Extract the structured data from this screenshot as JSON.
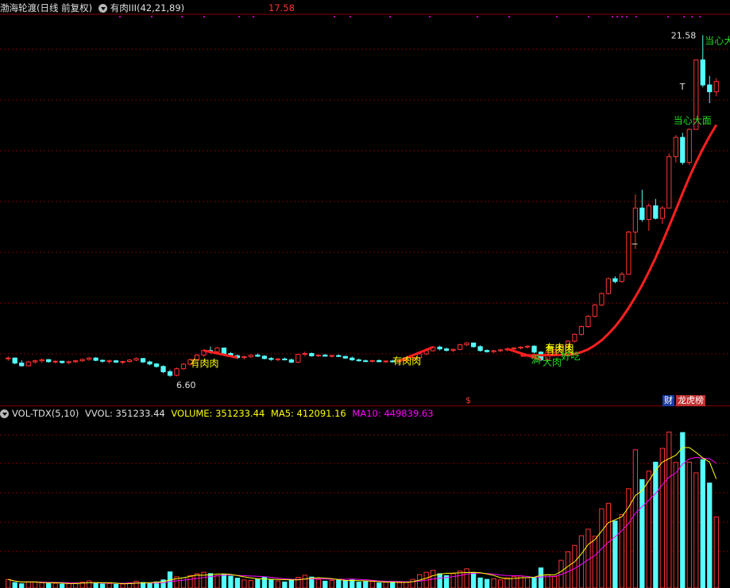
{
  "header": {
    "stock_title": "渤海轮渡(日线 前复权)",
    "indicator_name": "有肉III",
    "indicator_params": "(42,21,89)",
    "top_price": "17.58"
  },
  "volume_header": {
    "indicator": "VOL-TDX(5,10)",
    "vvol": "VVOL: 351233.44",
    "volume": "VOLUME: 351233.44",
    "ma5": "MA5: 412091.16",
    "ma10": "MA10: 449839.63"
  },
  "badges": {
    "cai": "财",
    "longhu": "龙虎榜",
    "dollar": "$"
  },
  "price_labels": {
    "low": "6.60",
    "high": "21.58"
  },
  "colors": {
    "up": "#ff3232",
    "down": "#54ffff",
    "grid": "#7a0000",
    "bull_line": "#ff2020",
    "ma5": "#ffff00",
    "ma10": "#ff00ff",
    "signal_green": "#22dd22",
    "signal_text": "#ffff00"
  },
  "chart_data": [
    {
      "type": "candlestick",
      "title": "渤海轮渡(日线 前复权)",
      "ylim": [
        6.0,
        22.5
      ],
      "candles": [
        [
          7.4,
          7.5,
          7.3,
          7.42
        ],
        [
          7.42,
          7.45,
          7.15,
          7.2
        ],
        [
          7.2,
          7.32,
          7.05,
          7.08
        ],
        [
          7.08,
          7.3,
          7.05,
          7.25
        ],
        [
          7.25,
          7.35,
          7.18,
          7.3
        ],
        [
          7.3,
          7.4,
          7.22,
          7.35
        ],
        [
          7.35,
          7.38,
          7.22,
          7.26
        ],
        [
          7.26,
          7.32,
          7.18,
          7.28
        ],
        [
          7.28,
          7.3,
          7.18,
          7.22
        ],
        [
          7.22,
          7.3,
          7.15,
          7.26
        ],
        [
          7.26,
          7.34,
          7.2,
          7.3
        ],
        [
          7.3,
          7.4,
          7.25,
          7.36
        ],
        [
          7.36,
          7.48,
          7.3,
          7.42
        ],
        [
          7.42,
          7.46,
          7.28,
          7.32
        ],
        [
          7.32,
          7.36,
          7.22,
          7.28
        ],
        [
          7.28,
          7.35,
          7.18,
          7.3
        ],
        [
          7.3,
          7.34,
          7.2,
          7.24
        ],
        [
          7.24,
          7.3,
          7.15,
          7.27
        ],
        [
          7.27,
          7.38,
          7.22,
          7.33
        ],
        [
          7.33,
          7.45,
          7.28,
          7.4
        ],
        [
          7.4,
          7.42,
          7.2,
          7.25
        ],
        [
          7.25,
          7.3,
          7.1,
          7.16
        ],
        [
          7.16,
          7.2,
          7.0,
          7.05
        ],
        [
          7.05,
          7.1,
          6.75,
          6.82
        ],
        [
          6.82,
          6.9,
          6.6,
          6.66
        ],
        [
          6.66,
          7.0,
          6.62,
          6.95
        ],
        [
          6.95,
          7.2,
          6.9,
          7.15
        ],
        [
          7.15,
          7.4,
          7.1,
          7.35
        ],
        [
          7.35,
          7.6,
          7.3,
          7.55
        ],
        [
          7.55,
          7.8,
          7.48,
          7.75
        ],
        [
          7.75,
          7.92,
          7.62,
          7.7
        ],
        [
          7.7,
          7.9,
          7.6,
          7.86
        ],
        [
          7.86,
          7.88,
          7.55,
          7.62
        ],
        [
          7.62,
          7.68,
          7.45,
          7.52
        ],
        [
          7.52,
          7.58,
          7.38,
          7.44
        ],
        [
          7.44,
          7.52,
          7.36,
          7.48
        ],
        [
          7.48,
          7.58,
          7.42,
          7.55
        ],
        [
          7.55,
          7.62,
          7.46,
          7.5
        ],
        [
          7.5,
          7.55,
          7.36,
          7.4
        ],
        [
          7.4,
          7.46,
          7.3,
          7.36
        ],
        [
          7.36,
          7.42,
          7.28,
          7.38
        ],
        [
          7.38,
          7.44,
          7.32,
          7.34
        ],
        [
          7.34,
          7.4,
          7.2,
          7.24
        ],
        [
          7.24,
          7.6,
          7.2,
          7.58
        ],
        [
          7.58,
          7.7,
          7.5,
          7.62
        ],
        [
          7.62,
          7.66,
          7.48,
          7.52
        ],
        [
          7.52,
          7.58,
          7.46,
          7.55
        ],
        [
          7.55,
          7.6,
          7.48,
          7.5
        ],
        [
          7.5,
          7.56,
          7.44,
          7.53
        ],
        [
          7.53,
          7.58,
          7.46,
          7.49
        ],
        [
          7.49,
          7.52,
          7.38,
          7.42
        ],
        [
          7.42,
          7.48,
          7.3,
          7.34
        ],
        [
          7.34,
          7.4,
          7.26,
          7.3
        ],
        [
          7.3,
          7.35,
          7.24,
          7.28
        ],
        [
          7.28,
          7.34,
          7.22,
          7.31
        ],
        [
          7.31,
          7.36,
          7.24,
          7.26
        ],
        [
          7.26,
          7.32,
          7.2,
          7.29
        ],
        [
          7.29,
          7.34,
          7.22,
          7.27
        ],
        [
          7.27,
          7.33,
          7.2,
          7.3
        ],
        [
          7.3,
          7.38,
          7.26,
          7.35
        ],
        [
          7.35,
          7.48,
          7.32,
          7.44
        ],
        [
          7.44,
          7.64,
          7.4,
          7.6
        ],
        [
          7.6,
          7.8,
          7.55,
          7.74
        ],
        [
          7.74,
          7.95,
          7.7,
          7.9
        ],
        [
          7.9,
          7.96,
          7.76,
          7.82
        ],
        [
          7.82,
          7.88,
          7.7,
          7.76
        ],
        [
          7.76,
          7.84,
          7.68,
          7.8
        ],
        [
          7.8,
          8.05,
          7.76,
          8.0
        ],
        [
          8.0,
          8.12,
          7.95,
          8.08
        ],
        [
          8.08,
          8.1,
          7.88,
          7.92
        ],
        [
          7.92,
          7.98,
          7.7,
          7.75
        ],
        [
          7.75,
          7.8,
          7.66,
          7.7
        ],
        [
          7.7,
          7.78,
          7.64,
          7.74
        ],
        [
          7.74,
          7.82,
          7.68,
          7.78
        ],
        [
          7.78,
          7.86,
          7.72,
          7.82
        ],
        [
          7.82,
          7.9,
          7.76,
          7.86
        ],
        [
          7.86,
          7.94,
          7.8,
          7.9
        ],
        [
          7.9,
          7.98,
          7.84,
          7.94
        ],
        [
          7.94,
          7.98,
          7.62,
          7.68
        ],
        [
          7.68,
          7.72,
          7.28,
          7.35
        ],
        [
          7.35,
          7.72,
          7.3,
          7.68
        ],
        [
          7.68,
          7.82,
          7.6,
          7.78
        ],
        [
          7.78,
          8.0,
          7.72,
          7.92
        ],
        [
          7.92,
          8.2,
          7.88,
          8.16
        ],
        [
          8.16,
          8.5,
          8.1,
          8.46
        ],
        [
          8.46,
          8.85,
          8.4,
          8.8
        ],
        [
          8.8,
          9.3,
          8.75,
          9.25
        ],
        [
          9.25,
          9.8,
          9.2,
          9.75
        ],
        [
          9.75,
          10.3,
          9.7,
          10.25
        ],
        [
          10.25,
          10.95,
          10.2,
          10.9
        ],
        [
          10.9,
          11.0,
          10.7,
          10.78
        ],
        [
          10.78,
          11.2,
          10.72,
          11.1
        ],
        [
          11.1,
          13.0,
          11.1,
          12.95
        ],
        [
          12.95,
          14.6,
          12.2,
          14.0
        ],
        [
          14.0,
          14.8,
          13.4,
          13.5
        ],
        [
          13.5,
          14.2,
          13.0,
          14.1
        ],
        [
          14.1,
          14.4,
          13.5,
          13.55
        ],
        [
          13.55,
          14.1,
          13.3,
          14.0
        ],
        [
          14.0,
          16.4,
          14.0,
          16.25
        ],
        [
          16.25,
          17.2,
          16.0,
          17.1
        ],
        [
          17.1,
          17.3,
          15.9,
          16.0
        ],
        [
          16.0,
          17.5,
          15.9,
          17.45
        ],
        [
          17.45,
          20.5,
          17.45,
          20.5
        ],
        [
          20.5,
          21.58,
          19.3,
          19.4
        ],
        [
          19.4,
          19.8,
          18.6,
          19.1
        ],
        [
          19.1,
          19.7,
          18.9,
          19.55
        ]
      ],
      "sell_line": [
        7.53,
        7.53,
        7.54,
        7.54,
        7.55,
        7.55,
        7.56,
        7.57,
        7.6,
        7.68,
        7.8,
        7.98,
        8.2,
        8.48,
        8.8,
        9.18,
        9.62,
        10.1,
        10.62,
        11.2,
        11.82,
        12.5,
        13.2,
        13.92,
        14.65,
        15.35,
        16.0,
        16.6,
        17.15,
        17.65
      ],
      "signals_buy": [
        "有肉肉",
        "有肉肉",
        "有肉肉",
        "有肉肉"
      ],
      "signal_sell_a": "当心大面",
      "signal_sell_b": "当心大面",
      "signal_eat_a": "大肉",
      "signal_eat_b": "好吃",
      "signal_eat_c": "满"
    },
    {
      "type": "bar",
      "title": "VOL-TDX(5,10)",
      "ylim": [
        0,
        1300000
      ],
      "volume": [
        66000,
        42000,
        33000,
        48000,
        47000,
        41000,
        34000,
        37000,
        30000,
        34000,
        40000,
        46000,
        55000,
        37000,
        31000,
        35000,
        29000,
        32000,
        41000,
        52000,
        43000,
        39000,
        47000,
        63000,
        125000,
        87000,
        79000,
        97000,
        111000,
        122000,
        112000,
        96000,
        105000,
        92000,
        76000,
        62000,
        58000,
        71000,
        85000,
        64000,
        55000,
        47000,
        66000,
        83000,
        99000,
        85000,
        67000,
        53000,
        58000,
        63000,
        56000,
        62000,
        46000,
        49000,
        52000,
        39000,
        45000,
        44000,
        42000,
        47000,
        67000,
        104000,
        122000,
        137000,
        111000,
        96000,
        113000,
        131000,
        149000,
        121000,
        78000,
        67000,
        72000,
        63000,
        79000,
        88000,
        94000,
        81000,
        78000,
        156000,
        103000,
        89000,
        215000,
        281000,
        331000,
        406000,
        457000,
        402000,
        615000,
        658000,
        520000,
        571000,
        771000,
        1073000,
        842000,
        908000,
        977000,
        1084000,
        1211000,
        975000,
        1207000,
        977000,
        894000,
        997000,
        815000,
        551000
      ],
      "volume_label_latest": 351233.44,
      "ma5_latest": 412091.16,
      "ma10_latest": 449839.63
    }
  ]
}
